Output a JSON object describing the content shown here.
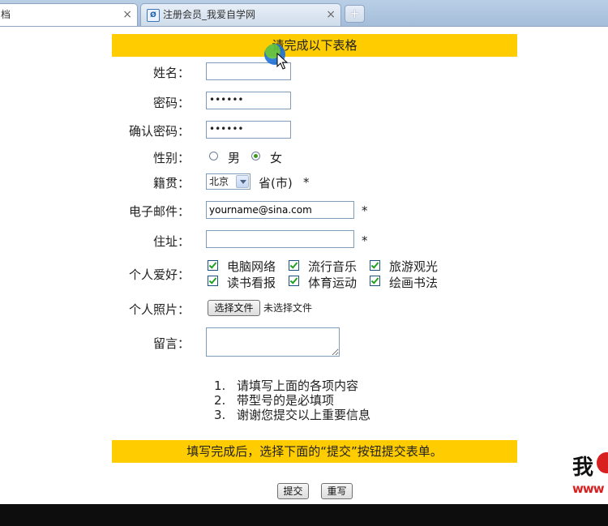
{
  "browser": {
    "active_tab_title": "档",
    "inactive_tab_title": "注册会员_我爱自学网",
    "close_glyph": "×",
    "new_tab_glyph": "+"
  },
  "form": {
    "header": "请完成以下表格",
    "name": {
      "label": "姓名：",
      "value": ""
    },
    "password": {
      "label": "密码：",
      "value": "••••••"
    },
    "confirm_password": {
      "label": "确认密码：",
      "value": "••••••"
    },
    "gender": {
      "label": "性别：",
      "options": [
        "男",
        "女"
      ],
      "selected": "女"
    },
    "hometown": {
      "label": "籍贯：",
      "selected": "北京",
      "suffix": "省(市)",
      "required_mark": "*"
    },
    "email": {
      "label": "电子邮件：",
      "value": "yourname@sina.com",
      "required_mark": "*"
    },
    "address": {
      "label": "住址：",
      "value": "",
      "required_mark": "*"
    },
    "hobbies": {
      "label": "个人爱好：",
      "options": [
        {
          "label": "电脑网络",
          "checked": true
        },
        {
          "label": "流行音乐",
          "checked": true
        },
        {
          "label": "旅游观光",
          "checked": true
        },
        {
          "label": "读书看报",
          "checked": true
        },
        {
          "label": "体育运动",
          "checked": true
        },
        {
          "label": "绘画书法",
          "checked": true
        }
      ]
    },
    "photo": {
      "label": "个人照片：",
      "button": "选择文件",
      "status": "未选择文件"
    },
    "message": {
      "label": "留言：",
      "value": ""
    }
  },
  "notes": {
    "items": [
      {
        "num": "1.",
        "text": "请填写上面的各项内容"
      },
      {
        "num": "2.",
        "text": "带型号的是必填项"
      },
      {
        "num": "3.",
        "text": "谢谢您提交以上重要信息"
      }
    ]
  },
  "footer_banner": "填写完成后，选择下面的“提交”按钮提交表单。",
  "buttons": {
    "submit": "提交",
    "reset": "重写"
  },
  "watermark": {
    "char": "我",
    "url_fragment": "www"
  },
  "colors": {
    "banner": "#ffcc00",
    "check": "#21a121"
  }
}
